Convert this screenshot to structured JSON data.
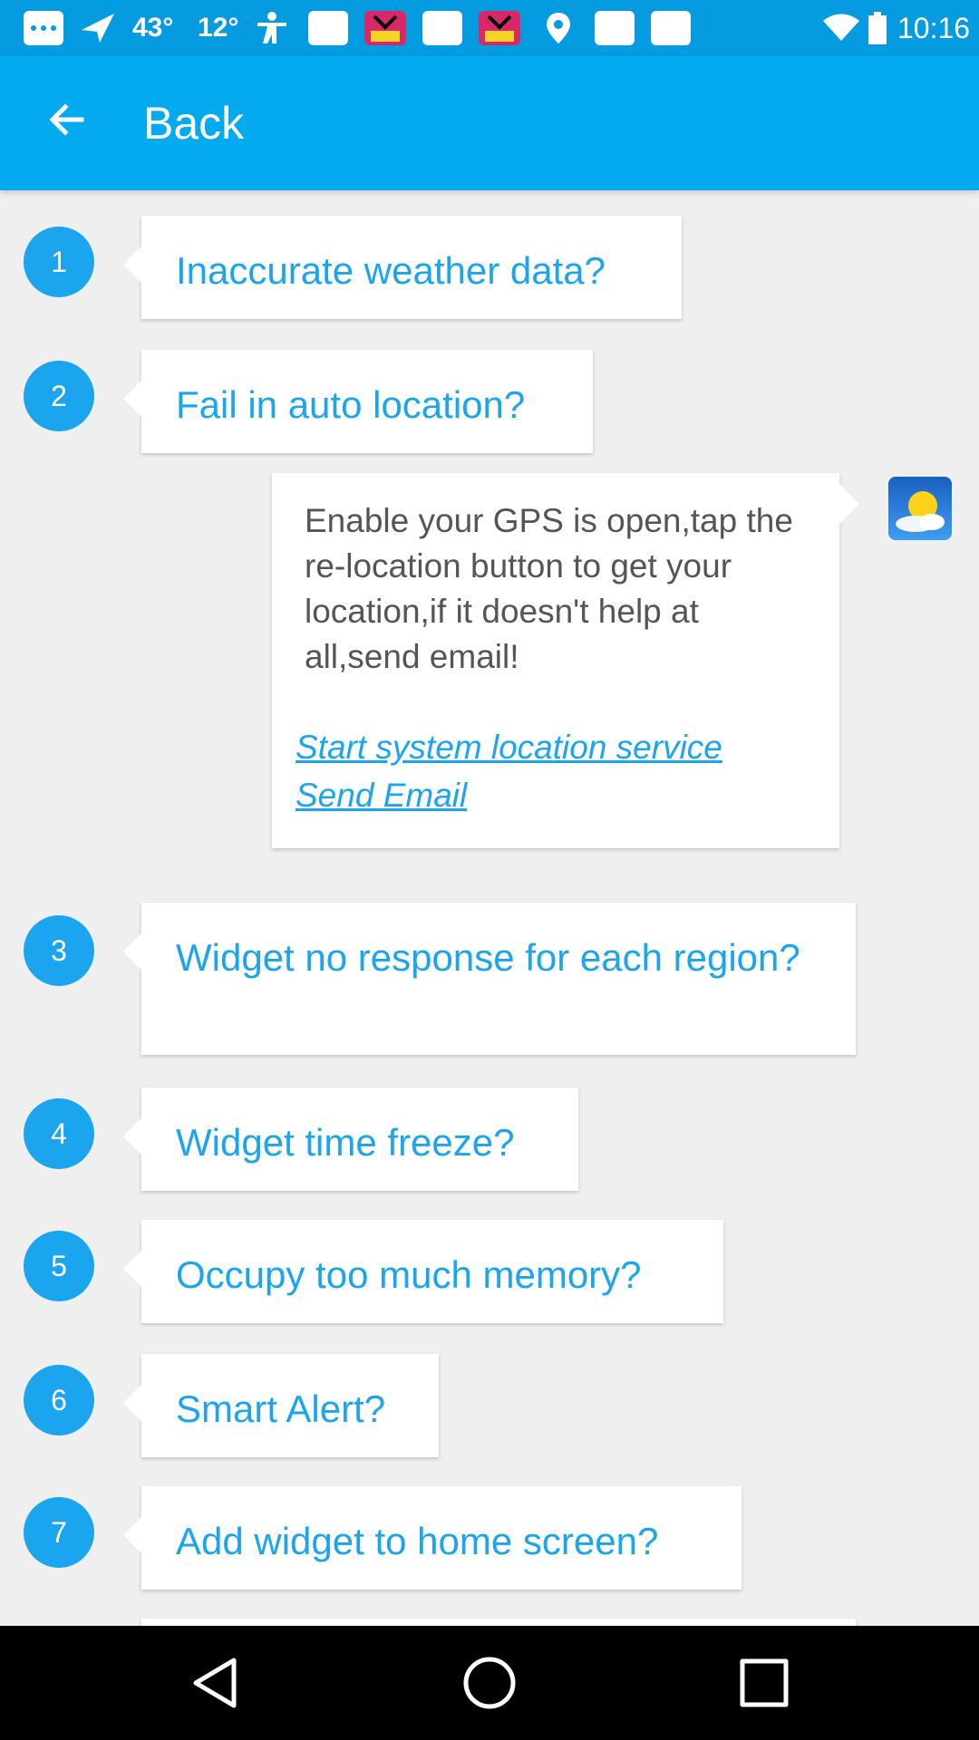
{
  "status_bar": {
    "temp1": "43°",
    "temp2": "12°",
    "time": "10:16"
  },
  "appbar": {
    "title": "Back",
    "back_icon": "arrow-left-icon"
  },
  "faq": [
    {
      "number": "1",
      "question": "Inaccurate weather data?"
    },
    {
      "number": "2",
      "question": "Fail in auto location?"
    },
    {
      "number": "3",
      "question": "Widget no response for each region?"
    },
    {
      "number": "4",
      "question": "Widget time freeze?"
    },
    {
      "number": "5",
      "question": "Occupy too much memory?"
    },
    {
      "number": "6",
      "question": "Smart Alert?"
    },
    {
      "number": "7",
      "question": "Add widget to home screen?"
    }
  ],
  "answer": {
    "text": "Enable your GPS is open,tap the re-location button to get your location,if it doesn't help at all,send email!",
    "link_location": "Start system location service",
    "link_email": "Send Email",
    "icon": "weather-sun-cloud-icon"
  },
  "colors": {
    "primary": "#04aaef",
    "status_bar": "#049be0",
    "accent": "#1ba5ef",
    "background": "#efefef"
  }
}
